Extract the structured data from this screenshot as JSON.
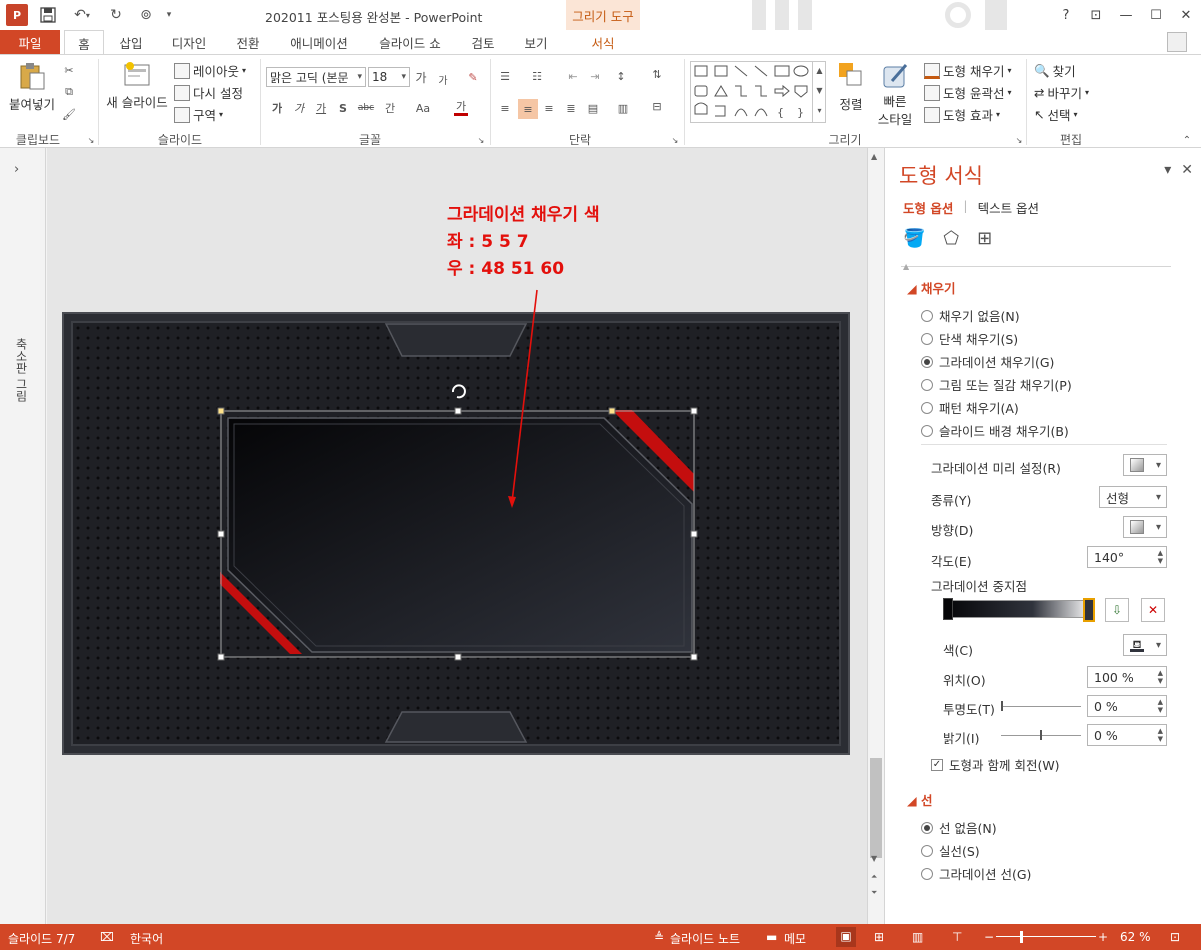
{
  "titlebar": {
    "app_logo": "P",
    "doc_title": "202011 포스팅용 완성본 - PowerPoint",
    "context_tab_label": "그리기 도구",
    "help": "?",
    "ribbon_display": "⊡",
    "minimize": "—",
    "restore": "☐",
    "close": "✕"
  },
  "tabs": {
    "file": "파일",
    "home": "홈",
    "insert": "삽입",
    "design": "디자인",
    "transitions": "전환",
    "animations": "애니메이션",
    "slideshow": "슬라이드 쇼",
    "review": "검토",
    "view": "보기",
    "format": "서식"
  },
  "ribbon": {
    "clipboard": {
      "paste": "붙여넣기",
      "label": "클립보드"
    },
    "slides": {
      "new_slide": "새 슬라이드",
      "layout": "레이아웃",
      "reset": "다시 설정",
      "section": "구역",
      "label": "슬라이드"
    },
    "font": {
      "font_name": "맑은 고딕 (본문",
      "font_size": "18",
      "grow": "가",
      "shrink": "가",
      "bold": "가",
      "italic": "가",
      "underline": "가",
      "shadow": "S",
      "strike": "abc",
      "spacing": "간",
      "case": "Aa",
      "color": "가",
      "label": "글꼴"
    },
    "paragraph": {
      "label": "단락"
    },
    "drawing": {
      "arrange": "정렬",
      "quick_styles": "빠른",
      "quick_styles2": "스타일",
      "fill": "도형 채우기",
      "outline": "도형 윤곽선",
      "effects": "도형 효과",
      "label": "그리기"
    },
    "editing": {
      "find": "찾기",
      "replace": "바꾸기",
      "select": "선택",
      "label": "편집"
    }
  },
  "left_pane": {
    "label": "축소판 그림"
  },
  "annotation": {
    "line1": "그라데이션 채우기 색",
    "line2": "좌 : 5 5 7",
    "line3": "우 : 48 51 60"
  },
  "format_pane": {
    "title": "도형 서식",
    "tab_shape": "도형 옵션",
    "tab_text": "텍스트 옵션",
    "fill_section": "채우기",
    "fill_options": [
      {
        "label": "채우기 없음(N)",
        "selected": false
      },
      {
        "label": "단색 채우기(S)",
        "selected": false
      },
      {
        "label": "그라데이션 채우기(G)",
        "selected": true
      },
      {
        "label": "그림 또는 질감 채우기(P)",
        "selected": false
      },
      {
        "label": "패턴 채우기(A)",
        "selected": false
      },
      {
        "label": "슬라이드 배경 채우기(B)",
        "selected": false
      }
    ],
    "preset_label": "그라데이션 미리 설정(R)",
    "type_label": "종류(Y)",
    "type_value": "선형",
    "direction_label": "방향(D)",
    "angle_label": "각도(E)",
    "angle_value": "140°",
    "stops_label": "그라데이션 중지점",
    "color_label": "색(C)",
    "position_label": "위치(O)",
    "position_value": "100 %",
    "transparency_label": "투명도(T)",
    "transparency_value": "0 %",
    "brightness_label": "밝기(I)",
    "brightness_value": "0 %",
    "rotate_label": "도형과 함께 회전(W)",
    "rotate_checked": true,
    "line_section": "선",
    "line_options": [
      {
        "label": "선 없음(N)",
        "selected": true
      },
      {
        "label": "실선(S)",
        "selected": false
      },
      {
        "label": "그라데이션 선(G)",
        "selected": false
      }
    ]
  },
  "statusbar": {
    "slide_info": "슬라이드 7/7",
    "language": "한국어",
    "notes": "슬라이드 노트",
    "comments": "메모",
    "zoom": "62 %"
  },
  "colors": {
    "accent": "#d24726",
    "annotation": "#e3100c",
    "gradient_left": "#050507",
    "gradient_right": "#30333c",
    "red_stripe": "#c40e0e"
  }
}
